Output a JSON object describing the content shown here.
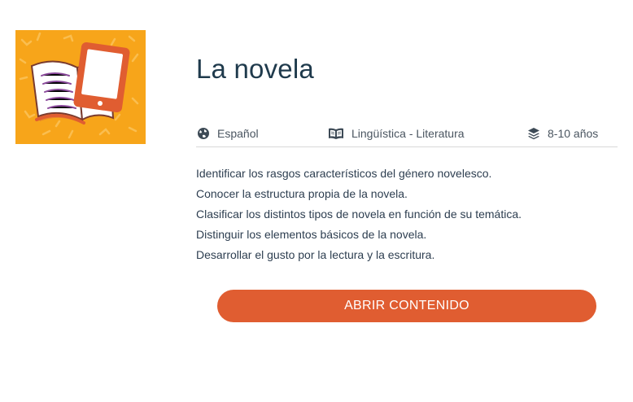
{
  "course": {
    "title": "La novela",
    "thumbnail_icon": "book-and-tablet-icon"
  },
  "meta": {
    "language": {
      "icon": "globe-icon",
      "label": "Español"
    },
    "subject": {
      "icon": "open-book-icon",
      "label": "Lingüística - Literatura"
    },
    "age": {
      "icon": "layers-icon",
      "label": "8-10 años"
    }
  },
  "objectives": [
    "Identificar los rasgos característicos del género novelesco.",
    "Conocer la estructura propia de la novela.",
    "Clasificar los distintos tipos de novela en función de su temática.",
    "Distinguir los elementos básicos de la novela.",
    "Desarrollar el gusto por la lectura y la escritura."
  ],
  "actions": {
    "open_label": "ABRIR CONTENIDO"
  },
  "colors": {
    "thumbnail_bg": "#f7a51a",
    "accent": "#e05d31",
    "title": "#1f3a4c"
  }
}
